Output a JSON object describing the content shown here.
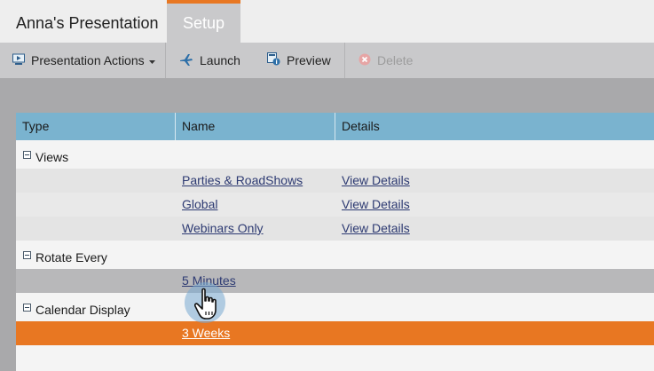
{
  "tabs": {
    "title": "Anna's Presentation",
    "setup": "Setup"
  },
  "toolbar": {
    "presentation_actions": "Presentation Actions",
    "launch": "Launch",
    "preview": "Preview",
    "delete": "Delete"
  },
  "table": {
    "headers": [
      "Type",
      "Name",
      "Details"
    ],
    "groups": [
      {
        "label": "Views",
        "rows": [
          {
            "name": "Parties & RoadShows",
            "details": "View Details"
          },
          {
            "name": "Global",
            "details": "View Details"
          },
          {
            "name": "Webinars Only",
            "details": "View Details"
          }
        ]
      },
      {
        "label": "Rotate Every",
        "rows": [
          {
            "name": "5 Minutes",
            "details": ""
          }
        ]
      },
      {
        "label": "Calendar Display",
        "rows": [
          {
            "name": "3 Weeks",
            "details": ""
          }
        ]
      }
    ]
  },
  "colors": {
    "accent": "#e87722",
    "header": "#7ab3cf",
    "link": "#2d3a72"
  }
}
